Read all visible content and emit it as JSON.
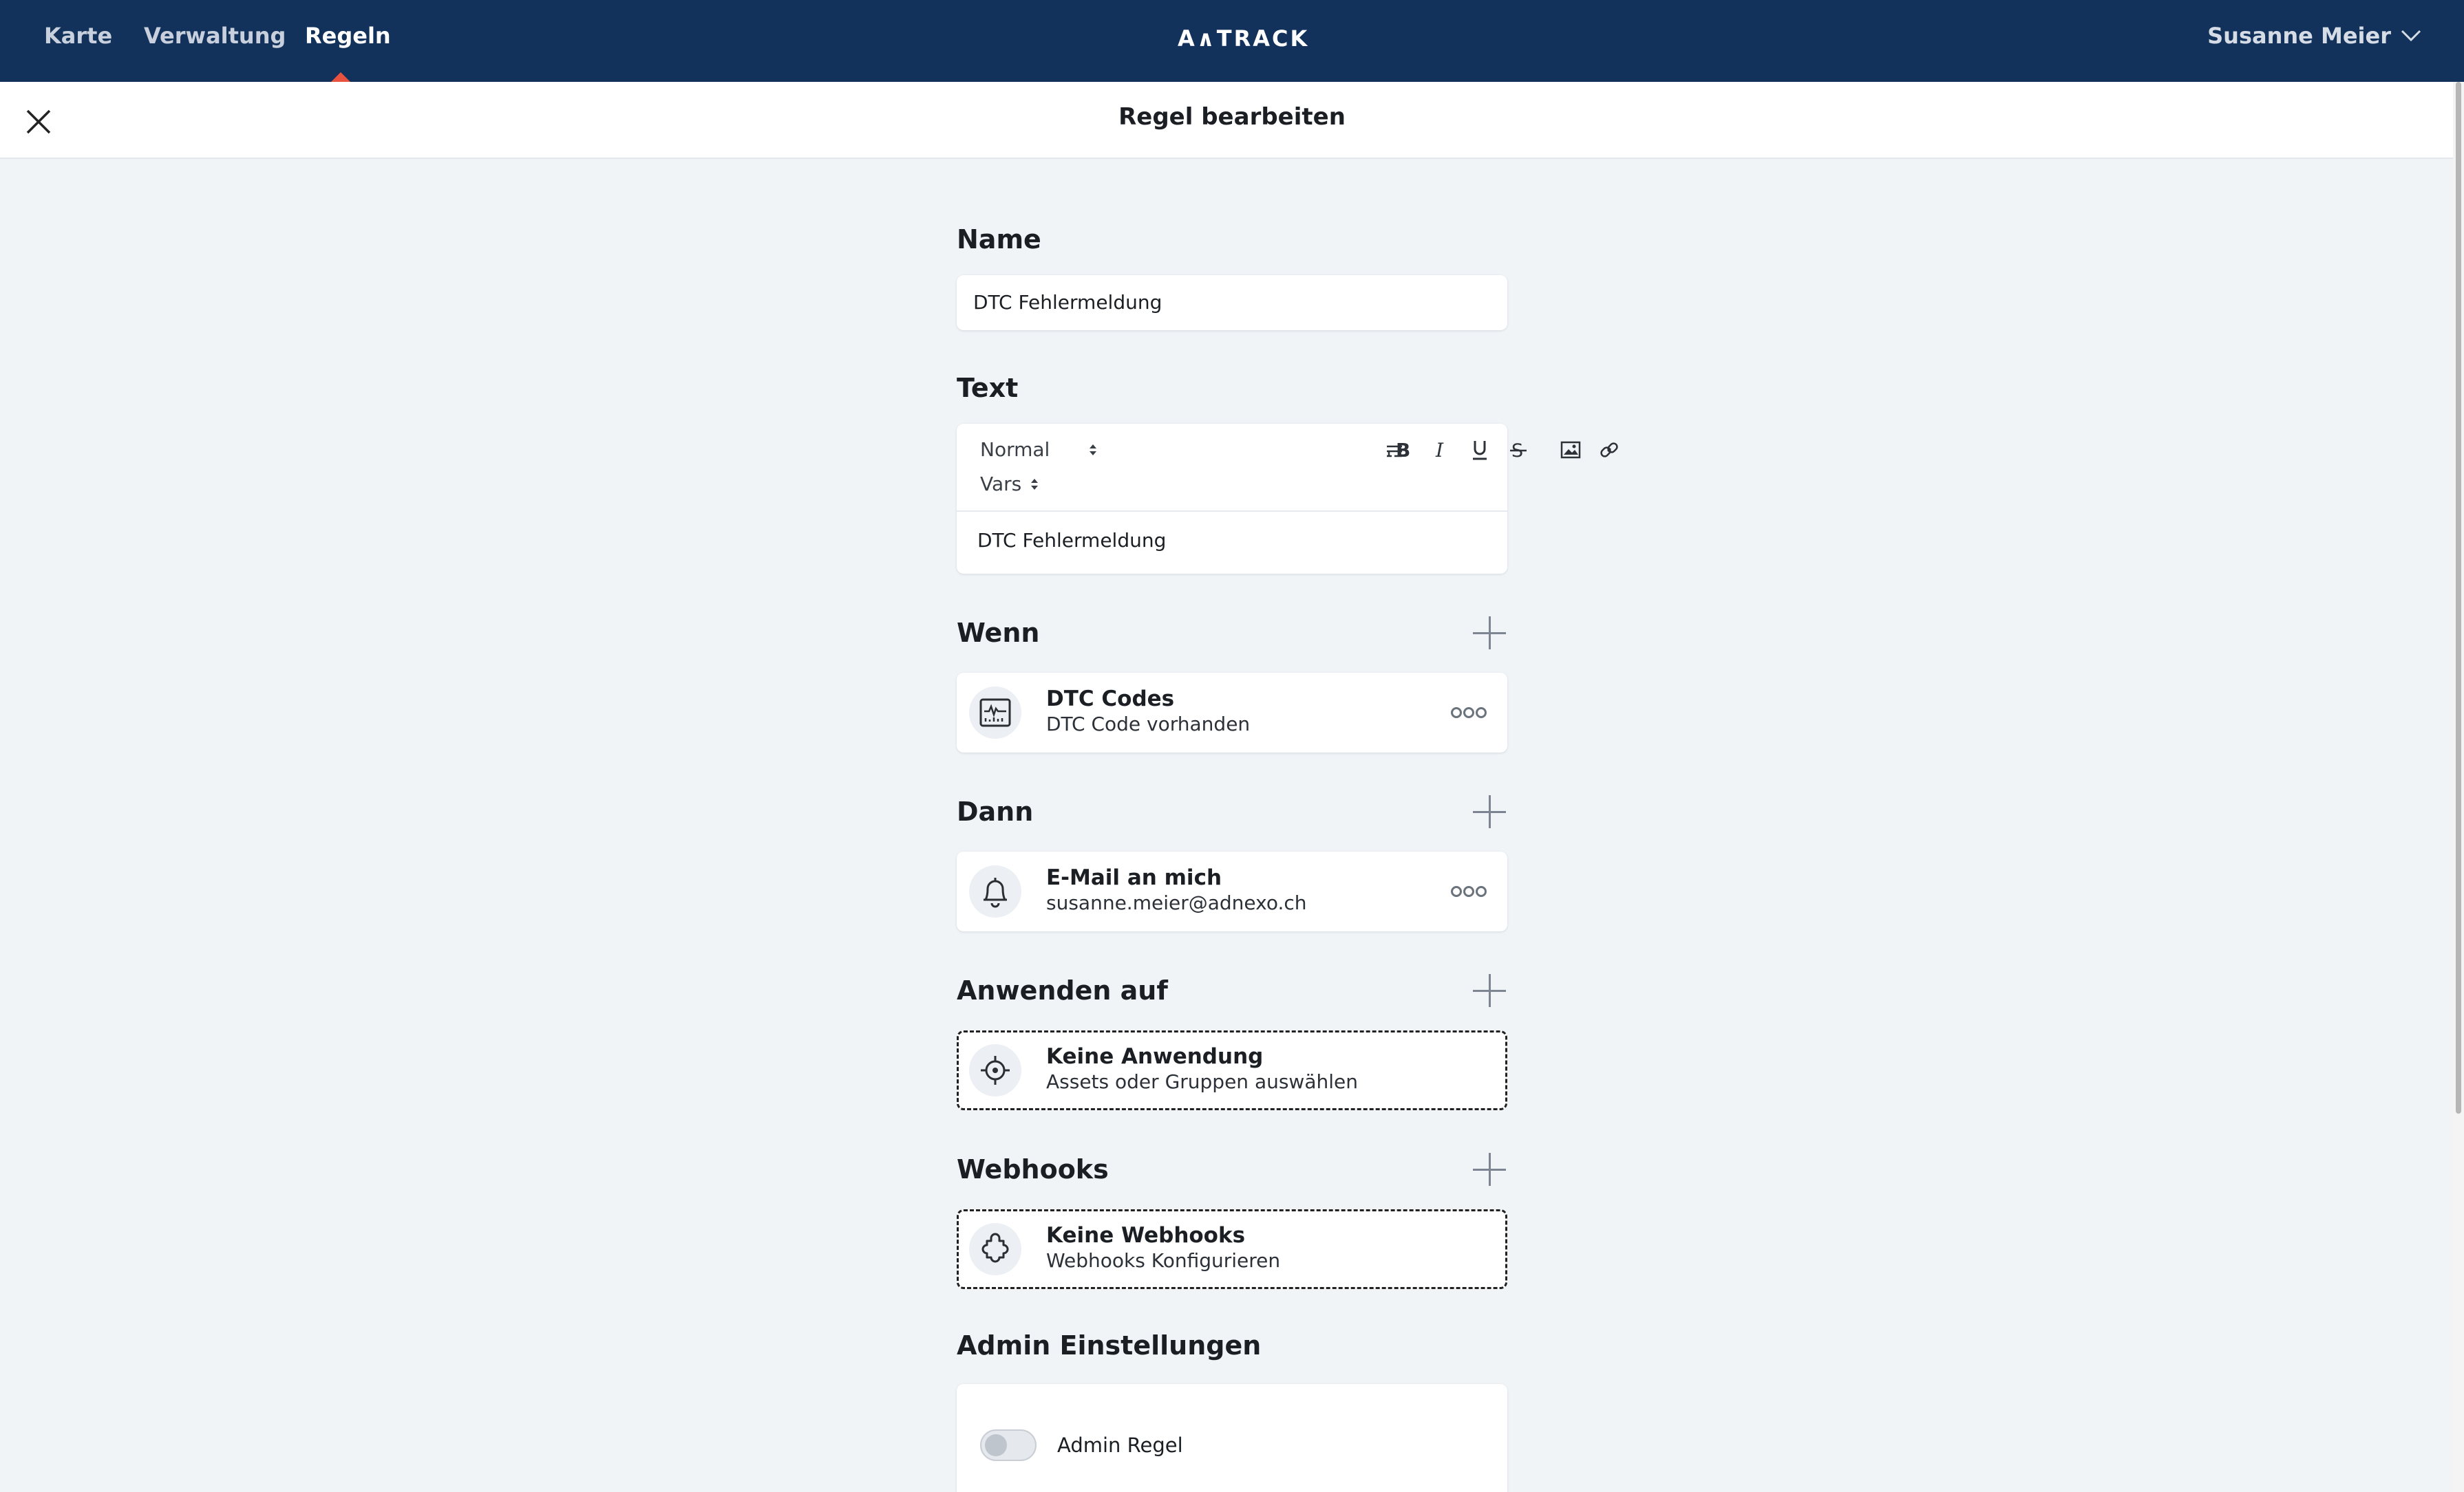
{
  "nav": {
    "items": [
      {
        "label": "Karte"
      },
      {
        "label": "Verwaltung"
      },
      {
        "label": "Regeln"
      }
    ],
    "active": "Regeln",
    "accent_color": "#e8523f",
    "background": "#13325b",
    "logo": "A∧TRACK",
    "user": "Susanne Meier"
  },
  "header": {
    "title": "Regel bearbeiten"
  },
  "form": {
    "name": {
      "label": "Name",
      "value": "DTC Fehlermeldung"
    },
    "text": {
      "label": "Text",
      "format_select": "Normal",
      "vars_select": "Vars",
      "content": "DTC Fehlermeldung",
      "toolbar_icons": [
        "bold-icon",
        "italic-icon",
        "underline-icon",
        "strikethrough-icon",
        "image-icon",
        "link-icon",
        "clear-format-icon"
      ]
    },
    "when": {
      "label": "Wenn",
      "item": {
        "title": "DTC Codes",
        "subtitle": "DTC Code vorhanden",
        "icon": "diagnostic-chart-icon"
      }
    },
    "then": {
      "label": "Dann",
      "item": {
        "title": "E-Mail an mich",
        "subtitle": "susanne.meier@adnexo.ch",
        "icon": "bell-icon"
      }
    },
    "apply_to": {
      "label": "Anwenden auf",
      "item": {
        "title": "Keine Anwendung",
        "subtitle": "Assets oder Gruppen auswählen",
        "icon": "target-icon"
      }
    },
    "webhooks": {
      "label": "Webhooks",
      "item": {
        "title": "Keine Webhooks",
        "subtitle": "Webhooks Konfigurieren",
        "icon": "puzzle-icon"
      }
    },
    "admin": {
      "label": "Admin Einstellungen",
      "toggle_label": "Admin Regel",
      "toggle_on": false
    }
  }
}
